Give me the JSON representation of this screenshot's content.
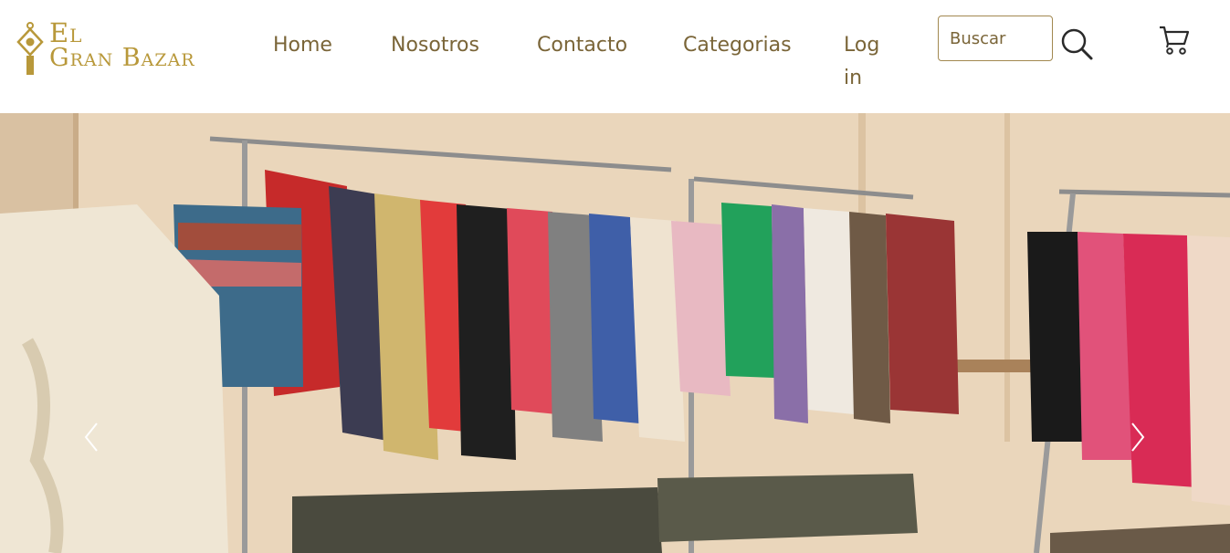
{
  "brand": {
    "line1": "El",
    "line2": "Gran Bazar",
    "accent": "#b8983a"
  },
  "nav": {
    "home": "Home",
    "nosotros": "Nosotros",
    "contacto": "Contacto",
    "categorias": "Categorias",
    "login_line1": "Log",
    "login_line2": "in"
  },
  "search": {
    "placeholder": "Buscar",
    "icon": "search-icon"
  },
  "cart": {
    "icon": "cart-icon"
  },
  "carousel": {
    "prev_icon": "chevron-left-icon",
    "next_icon": "chevron-right-icon"
  },
  "colors": {
    "nav_text": "#7a6538",
    "input_border": "#a28850"
  }
}
